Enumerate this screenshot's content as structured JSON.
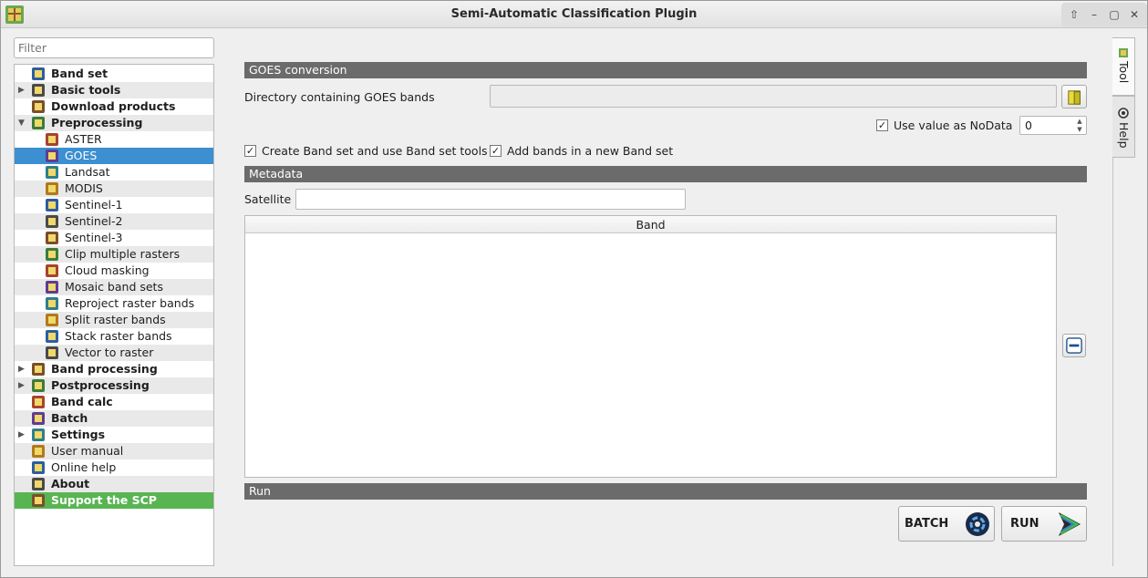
{
  "window": {
    "title": "Semi-Automatic Classification Plugin"
  },
  "filter": {
    "placeholder": "Filter"
  },
  "tree": [
    {
      "label": "Band set",
      "level": 0,
      "bold": true
    },
    {
      "label": "Basic tools",
      "level": 0,
      "bold": true,
      "arrow": "right"
    },
    {
      "label": "Download products",
      "level": 0,
      "bold": true
    },
    {
      "label": "Preprocessing",
      "level": 0,
      "bold": true,
      "arrow": "down"
    },
    {
      "label": "ASTER",
      "level": 1
    },
    {
      "label": "GOES",
      "level": 1,
      "selected": true
    },
    {
      "label": "Landsat",
      "level": 1
    },
    {
      "label": "MODIS",
      "level": 1
    },
    {
      "label": "Sentinel-1",
      "level": 1
    },
    {
      "label": "Sentinel-2",
      "level": 1
    },
    {
      "label": "Sentinel-3",
      "level": 1
    },
    {
      "label": "Clip multiple rasters",
      "level": 1
    },
    {
      "label": "Cloud masking",
      "level": 1
    },
    {
      "label": "Mosaic band sets",
      "level": 1
    },
    {
      "label": "Reproject raster bands",
      "level": 1
    },
    {
      "label": "Split raster bands",
      "level": 1
    },
    {
      "label": "Stack raster bands",
      "level": 1
    },
    {
      "label": "Vector to raster",
      "level": 1
    },
    {
      "label": "Band processing",
      "level": 0,
      "bold": true,
      "arrow": "right"
    },
    {
      "label": "Postprocessing",
      "level": 0,
      "bold": true,
      "arrow": "right"
    },
    {
      "label": "Band calc",
      "level": 0,
      "bold": true
    },
    {
      "label": "Batch",
      "level": 0,
      "bold": true
    },
    {
      "label": "Settings",
      "level": 0,
      "bold": true,
      "arrow": "right"
    },
    {
      "label": "User manual",
      "level": 0,
      "bold": false
    },
    {
      "label": "Online help",
      "level": 0,
      "bold": false
    },
    {
      "label": "About",
      "level": 0,
      "bold": true
    },
    {
      "label": "Support the SCP",
      "level": 0,
      "bold": true,
      "support": true
    }
  ],
  "goes": {
    "section_title": "GOES conversion",
    "directory_label": "Directory containing GOES bands",
    "directory_value": "",
    "nodata_label": "Use value as NoData",
    "nodata_checked": true,
    "nodata_value": "0",
    "create_bandset_label": "Create Band set and use Band set tools",
    "create_bandset_checked": true,
    "add_bands_label": "Add bands in a new Band set",
    "add_bands_checked": true
  },
  "metadata": {
    "section_title": "Metadata",
    "satellite_label": "Satellite",
    "satellite_value": "",
    "table_header": "Band"
  },
  "run": {
    "section_title": "Run",
    "batch_label": "BATCH",
    "run_label": "RUN"
  },
  "side_tabs": {
    "tool": "Tool",
    "help": "Help"
  },
  "colors": {
    "selected": "#3c8fd0",
    "support": "#58b552",
    "section_header": "#6b6b6b"
  }
}
